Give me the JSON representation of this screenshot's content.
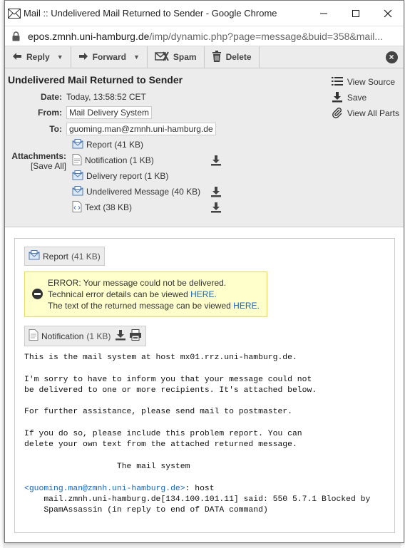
{
  "browser": {
    "window_title": "Mail :: Undelivered Mail Returned to Sender - Google Chrome",
    "url_host": "epos.zmnh.uni-hamburg.de",
    "url_path": "/imp/dynamic.php?page=message&buid=358&mail..."
  },
  "toolbar": {
    "reply": "Reply",
    "forward": "Forward",
    "spam": "Spam",
    "delete": "Delete"
  },
  "message": {
    "subject": "Undelivered Mail Returned to Sender",
    "date_label": "Date:",
    "date": "Today, 13:58:52 CET",
    "from_label": "From:",
    "from": "Mail Delivery System",
    "to_label": "To:",
    "to": "guoming.man@zmnh.uni-hamburg.de",
    "attachments_label": "Attachments:",
    "save_all": "[Save All]",
    "attachments": [
      {
        "name": "Report (41 KB)",
        "icon": "mail-part-icon",
        "download": false
      },
      {
        "name": "Notification (1 KB)",
        "icon": "document-icon",
        "download": true
      },
      {
        "name": "Delivery report (1 KB)",
        "icon": "mail-part-icon",
        "download": false
      },
      {
        "name": "Undelivered Message (40 KB)",
        "icon": "mail-part-icon",
        "download": true
      },
      {
        "name": "Text (38 KB)",
        "icon": "text-file-icon",
        "download": true
      }
    ]
  },
  "side_actions": {
    "view_source": "View Source",
    "save": "Save",
    "view_all_parts": "View All Parts"
  },
  "content": {
    "report_part": {
      "label": "Report",
      "size": "(41 KB)"
    },
    "error": {
      "line1": "ERROR: Your message could not be delivered.",
      "line2_prefix": "Technical error details can be viewed ",
      "line3_prefix": "The text of the returned message can be viewed ",
      "link": "HERE."
    },
    "notification_part": {
      "label": "Notification",
      "size": "(1 KB)"
    },
    "body": {
      "p1": "This is the mail system at host mx01.rrz.uni-hamburg.de.",
      "p2a": "I'm sorry to have to inform you that your message could not",
      "p2b": "be delivered to one or more recipients. It's attached below.",
      "p3": "For further assistance, please send mail to postmaster.",
      "p4a": "If you do so, please include this problem report. You can",
      "p4b": "delete your own text from the attached returned message.",
      "sig": "                   The mail system",
      "rcpt_link": "<guoming.man@zmnh.uni-hamburg.de>",
      "rcpt_tail": ": host",
      "d1": "    mail.zmnh.uni-hamburg.de[134.100.101.11] said: 550 5.7.1 Blocked by",
      "d2": "    SpamAssassin (in reply to end of DATA command)"
    }
  },
  "colors": {
    "header_bg": "#ececec",
    "error_bg": "#ffffcc",
    "link": "#1565c0"
  }
}
